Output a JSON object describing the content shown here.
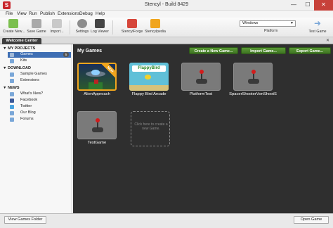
{
  "window": {
    "title": "Stencyl - Build 8429",
    "app_icon": "S",
    "minimize": "—",
    "maximize": "☐",
    "close": "✕"
  },
  "menu": [
    "File",
    "View",
    "Run",
    "Publish",
    "Extensions",
    "Debug",
    "Help"
  ],
  "toolbar": {
    "create_new": "Create New...",
    "save_game": "Save Game",
    "import": "Import...",
    "settings": "Settings",
    "log_viewer": "Log Viewer",
    "stencylforge": "StencylForge",
    "stencylpedia": "Stencylpedia",
    "platform_value": "Windows",
    "platform_label": "Platform",
    "test_game": "Test Game"
  },
  "tab": {
    "label": "Welcome Center",
    "close": "✕"
  },
  "sidebar": {
    "sections": [
      {
        "title": "MY PROJECTS",
        "items": [
          {
            "label": "Games",
            "icon": "games-icon"
          },
          {
            "label": "Kits",
            "icon": "kits-icon"
          }
        ]
      },
      {
        "title": "DOWNLOAD",
        "items": [
          {
            "label": "Sample Games",
            "icon": "sample-games-icon"
          },
          {
            "label": "Extensions",
            "icon": "extensions-icon"
          }
        ]
      },
      {
        "title": "NEWS",
        "items": [
          {
            "label": "What's New?",
            "icon": "whats-new-icon"
          },
          {
            "label": "Facebook",
            "icon": "facebook-icon"
          },
          {
            "label": "Twitter",
            "icon": "twitter-icon"
          },
          {
            "label": "Our Blog",
            "icon": "blog-icon"
          },
          {
            "label": "Forums",
            "icon": "forums-icon"
          }
        ]
      }
    ],
    "games_count": "5"
  },
  "main": {
    "title": "My Games",
    "create_button": "Create a New Game...",
    "import_button": "Import Game...",
    "export_button": "Export Game...",
    "games": [
      {
        "name": "AlienApproach",
        "banner": "NEW"
      },
      {
        "name": "Flappy Bird Arcade",
        "thumb_text": "FlappyBird"
      },
      {
        "name": "PlatformTest"
      },
      {
        "name": "SpacerShooterVonShootS"
      },
      {
        "name": "TestGame"
      }
    ],
    "new_game_hint": "Click here to create a new Game."
  },
  "statusbar": {
    "view_folder": "View Games Folder",
    "open_game": "Open Game"
  },
  "colors": {
    "accent_green": "#4a8a2c",
    "selection_blue": "#3f6fb4",
    "panel_dark": "#2f2f2f",
    "close_red": "#c7413a"
  }
}
